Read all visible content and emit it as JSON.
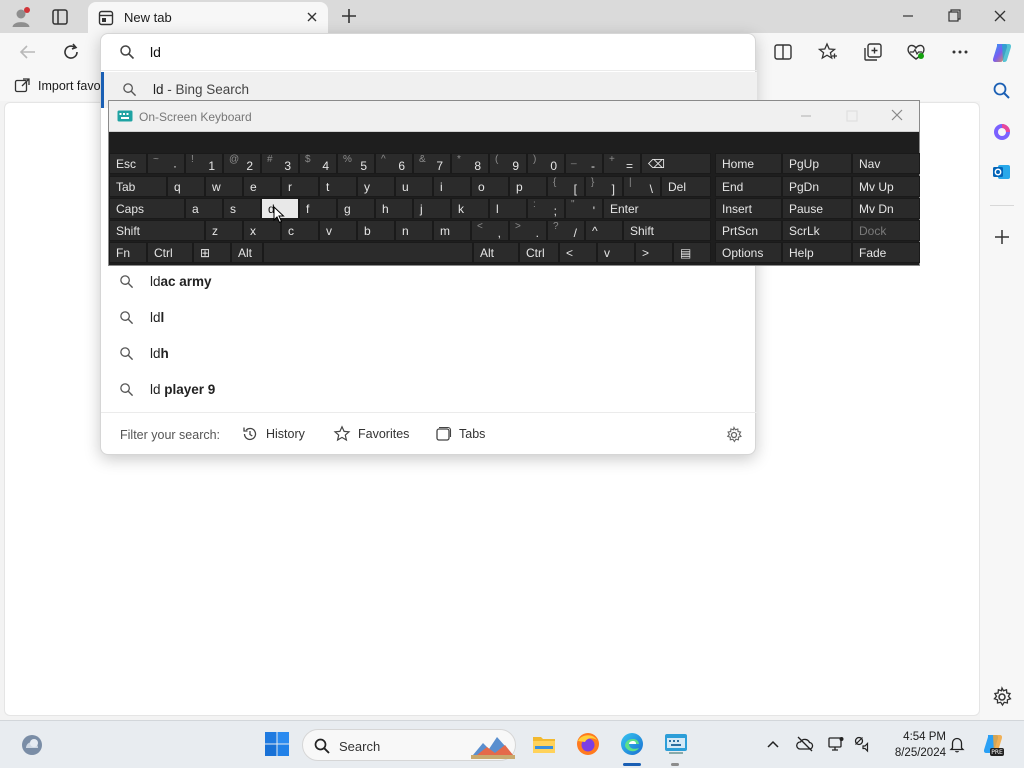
{
  "browser": {
    "tab_title": "New tab",
    "address_text": "ld",
    "favorites_import_label": "Import favo"
  },
  "suggestions": [
    {
      "prefix": "ld",
      "rest": " - Bing Search",
      "rest_bold": false
    },
    {
      "prefix": "ld",
      "rest": "ac army",
      "rest_bold": true
    },
    {
      "prefix": "ld",
      "rest": "l",
      "rest_bold": true
    },
    {
      "prefix": "ld",
      "rest": "h",
      "rest_bold": true
    },
    {
      "prefix": "ld",
      "rest": " player 9",
      "rest_bold": true
    }
  ],
  "filter_bar": {
    "label": "Filter your search:",
    "history": "History",
    "favorites": "Favorites",
    "tabs": "Tabs"
  },
  "osk": {
    "title": "On-Screen Keyboard",
    "row1": [
      {
        "main": "Esc"
      },
      {
        "main": "·",
        "shift": "~"
      },
      {
        "main": "1",
        "shift": "!"
      },
      {
        "main": "2",
        "shift": "@"
      },
      {
        "main": "3",
        "shift": "#"
      },
      {
        "main": "4",
        "shift": "$"
      },
      {
        "main": "5",
        "shift": "%"
      },
      {
        "main": "6",
        "shift": "^"
      },
      {
        "main": "7",
        "shift": "&"
      },
      {
        "main": "8",
        "shift": "*"
      },
      {
        "main": "9",
        "shift": "("
      },
      {
        "main": "0",
        "shift": ")"
      },
      {
        "main": "-",
        "shift": "_"
      },
      {
        "main": "=",
        "shift": "+"
      },
      {
        "main": "⌫"
      }
    ],
    "row2": [
      {
        "main": "Tab"
      },
      {
        "main": "q"
      },
      {
        "main": "w"
      },
      {
        "main": "e"
      },
      {
        "main": "r"
      },
      {
        "main": "t"
      },
      {
        "main": "y"
      },
      {
        "main": "u"
      },
      {
        "main": "i"
      },
      {
        "main": "o"
      },
      {
        "main": "p"
      },
      {
        "main": "[",
        "shift": "{"
      },
      {
        "main": "]",
        "shift": "}"
      },
      {
        "main": "\\",
        "shift": "|"
      },
      {
        "main": "Del"
      }
    ],
    "row3": [
      {
        "main": "Caps"
      },
      {
        "main": "a"
      },
      {
        "main": "s"
      },
      {
        "main": "d"
      },
      {
        "main": "f"
      },
      {
        "main": "g"
      },
      {
        "main": "h"
      },
      {
        "main": "j"
      },
      {
        "main": "k"
      },
      {
        "main": "l"
      },
      {
        "main": ";",
        "shift": ":"
      },
      {
        "main": "'",
        "shift": "\""
      },
      {
        "main": "Enter"
      }
    ],
    "row4": [
      {
        "main": "Shift"
      },
      {
        "main": "z"
      },
      {
        "main": "x"
      },
      {
        "main": "c"
      },
      {
        "main": "v"
      },
      {
        "main": "b"
      },
      {
        "main": "n"
      },
      {
        "main": "m"
      },
      {
        "main": ",",
        "shift": "<"
      },
      {
        "main": ".",
        "shift": ">"
      },
      {
        "main": "/",
        "shift": "?"
      },
      {
        "main": "^"
      },
      {
        "main": "Shift"
      }
    ],
    "row5": [
      {
        "main": "Fn"
      },
      {
        "main": "Ctrl"
      },
      {
        "main": "⊞"
      },
      {
        "main": "Alt"
      },
      {
        "main": ""
      },
      {
        "main": "Alt"
      },
      {
        "main": "Ctrl"
      },
      {
        "main": "<"
      },
      {
        "main": "v"
      },
      {
        "main": ">"
      },
      {
        "main": "▤"
      }
    ],
    "nav": [
      [
        "Home",
        "PgUp",
        "Nav"
      ],
      [
        "End",
        "PgDn",
        "Mv Up"
      ],
      [
        "Insert",
        "Pause",
        "Mv Dn"
      ],
      [
        "PrtScn",
        "ScrLk",
        "Dock"
      ],
      [
        "Options",
        "Help",
        "Fade"
      ]
    ]
  },
  "taskbar": {
    "search_label": "Search",
    "time": "4:54 PM",
    "date": "8/25/2024"
  },
  "colors": {
    "accent": "#1a5fb4",
    "osk_bg": "#1e1e1e",
    "osk_key": "#2b2b2b",
    "highlight_key": "#e8e8e8"
  }
}
